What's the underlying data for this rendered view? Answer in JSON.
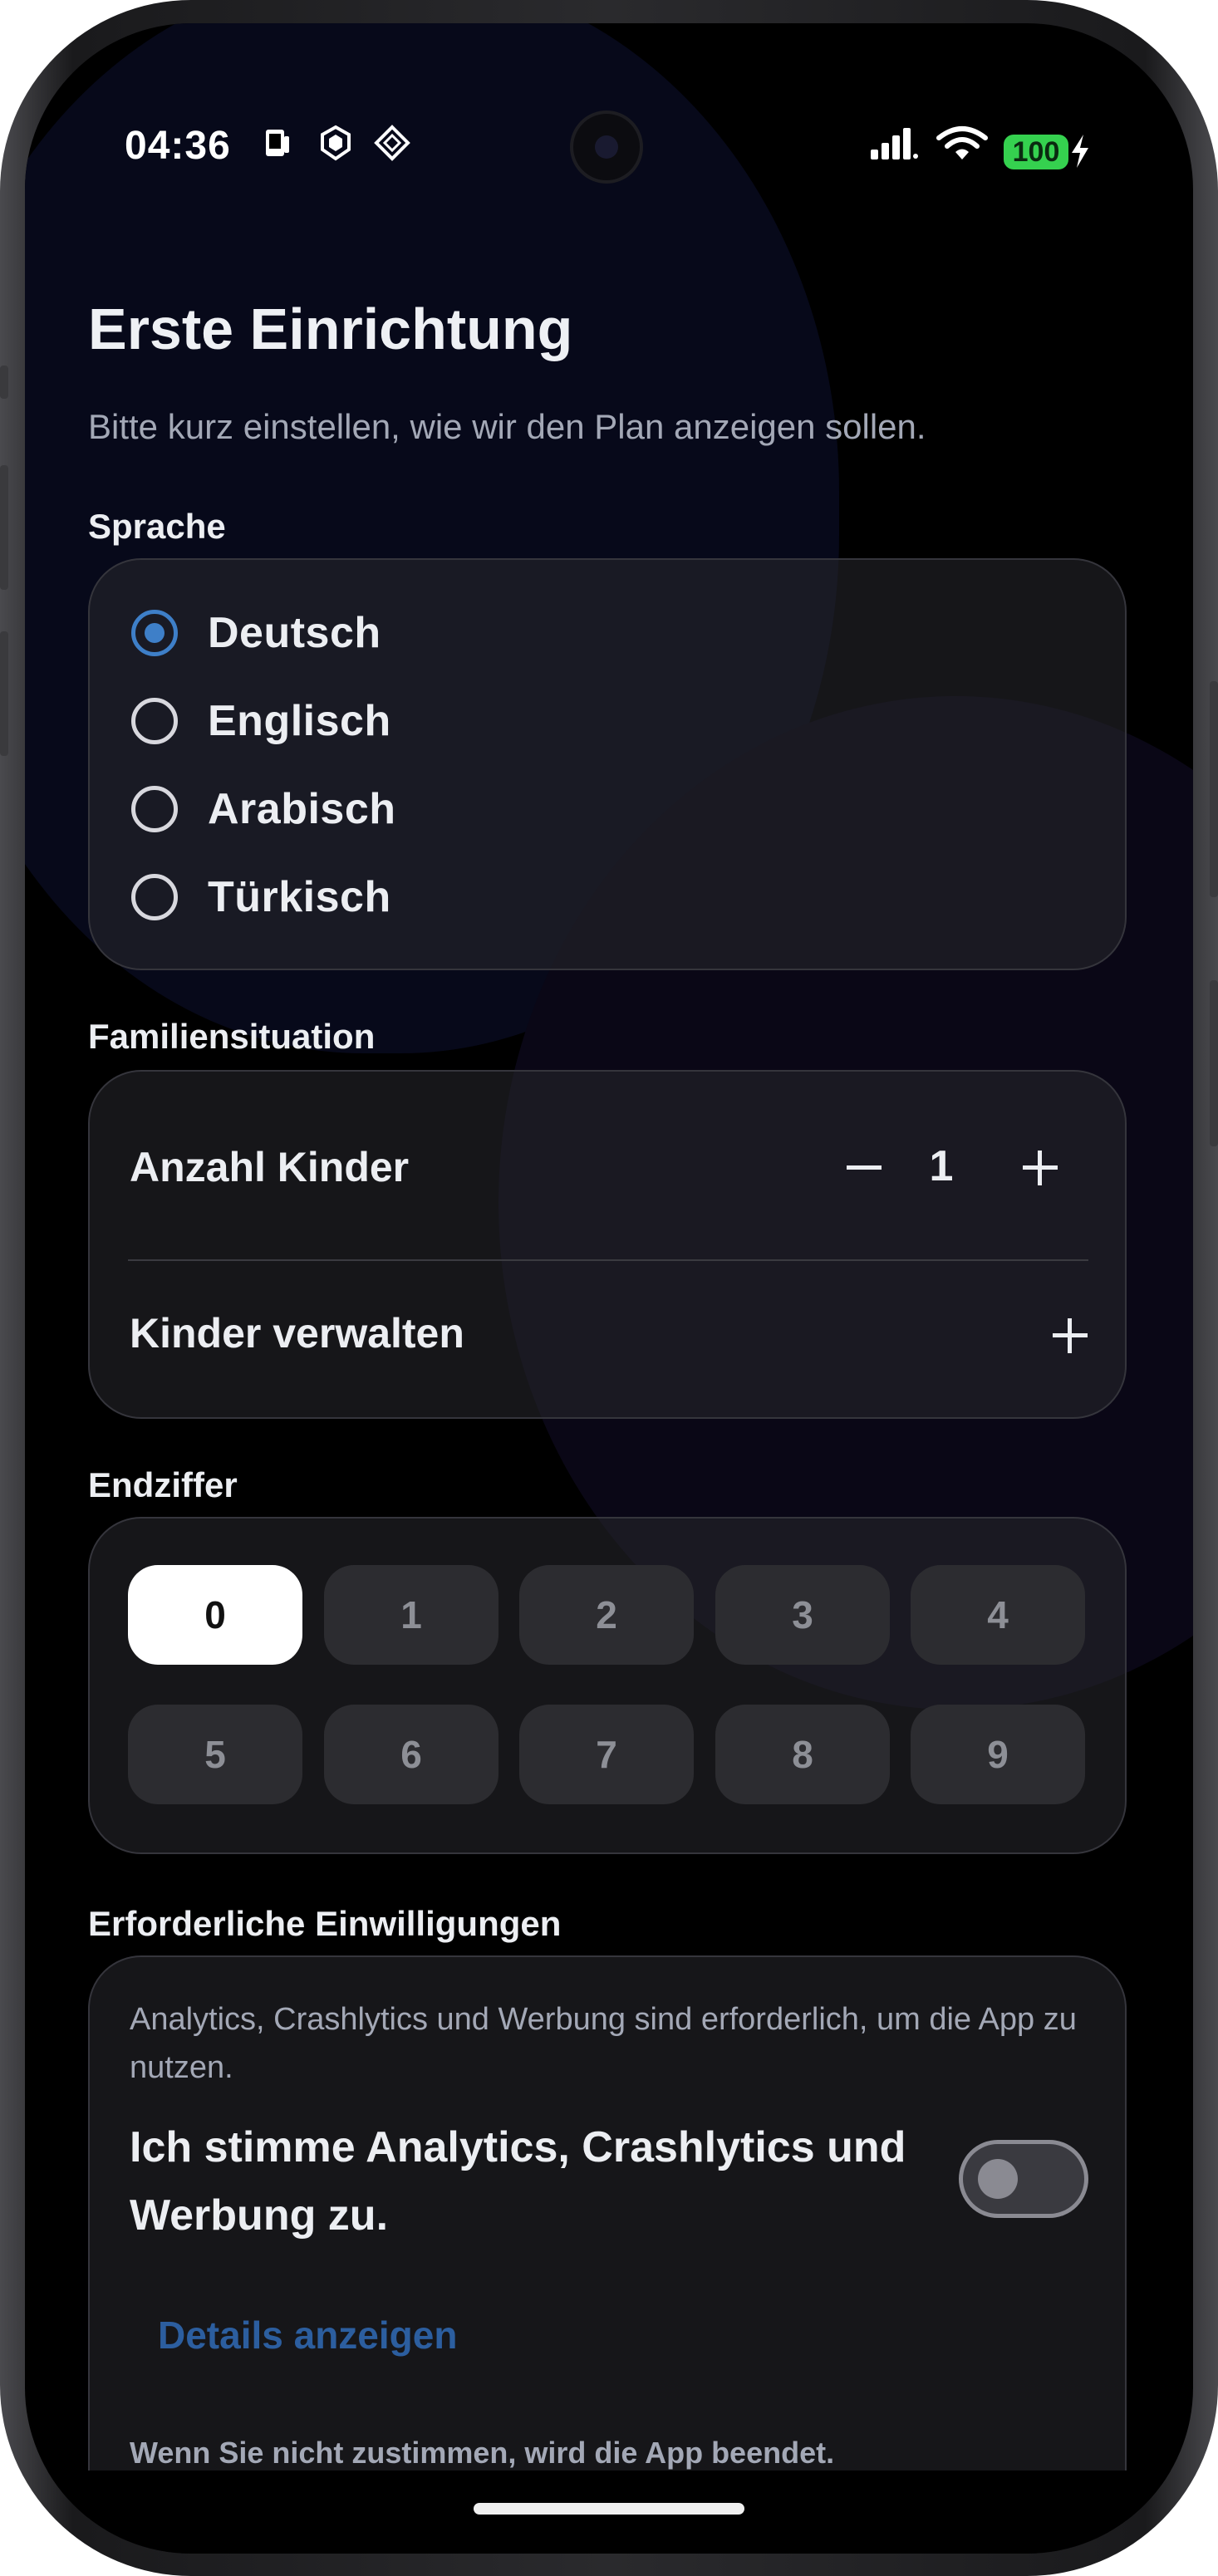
{
  "status_bar": {
    "time": "04:36",
    "battery": "100",
    "icons": [
      "phone-screen-icon",
      "shield-icon",
      "diamond-icon",
      "signal-icon",
      "wifi-icon",
      "battery-icon",
      "charging-bolt-icon"
    ]
  },
  "header": {
    "title": "Erste Einrichtung",
    "subtitle": "Bitte kurz einstellen, wie wir den Plan anzeigen sollen."
  },
  "language": {
    "label": "Sprache",
    "options": [
      "Deutsch",
      "Englisch",
      "Arabisch",
      "Türkisch"
    ],
    "selected": "Deutsch"
  },
  "family": {
    "label": "Familiensituation",
    "children_count_label": "Anzahl Kinder",
    "children_count": "1",
    "manage_children_label": "Kinder verwalten"
  },
  "end_digit": {
    "label": "Endziffer",
    "digits": [
      "0",
      "1",
      "2",
      "3",
      "4",
      "5",
      "6",
      "7",
      "8",
      "9"
    ],
    "selected": "0"
  },
  "consent": {
    "label": "Erforderliche Einwilligungen",
    "info": "Analytics, Crashlytics und Werbung sind erforderlich, um die App zu nutzen.",
    "toggle_label": "Ich stimme Analytics, Crashlytics und Werbung zu.",
    "toggle_on": false,
    "details_link": "Details anzeigen",
    "note": "Wenn Sie nicht zustimmen, wird die App beendet."
  },
  "colors": {
    "accent": "#3e7fc8",
    "link": "#2c5e9f",
    "battery": "#35d14f",
    "background": "#000000"
  }
}
